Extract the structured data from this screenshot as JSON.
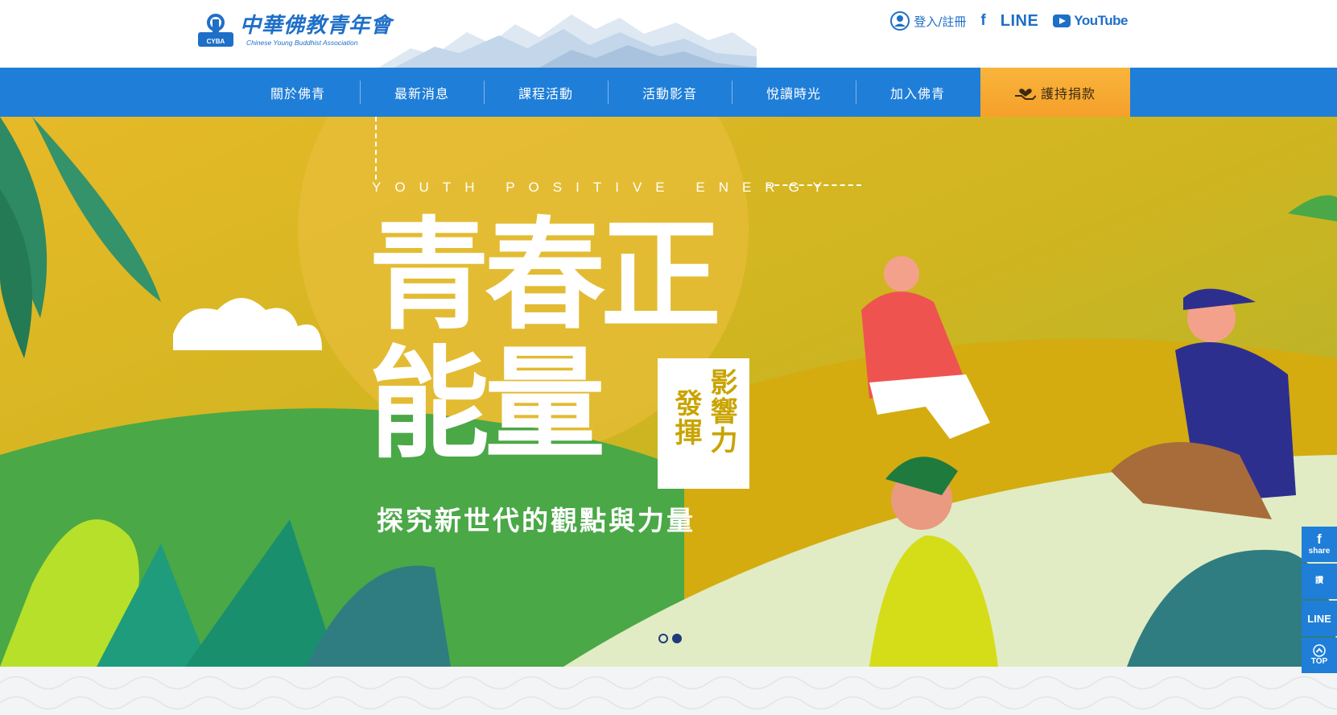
{
  "header": {
    "logo_title": "中華佛教青年會",
    "logo_sub": "Chinese Young Buddhist Association",
    "logo_badge": "CYBA",
    "login_label": "登入/註冊",
    "social": {
      "facebook": "f",
      "line": "LINE",
      "youtube": "YouTube"
    }
  },
  "nav": {
    "items": [
      {
        "label": "關於佛青"
      },
      {
        "label": "最新消息"
      },
      {
        "label": "課程活動"
      },
      {
        "label": "活動影音"
      },
      {
        "label": "悅讀時光"
      },
      {
        "label": "加入佛青"
      }
    ],
    "donate_label": "護持捐款"
  },
  "hero": {
    "tagline": "YOUTH POSITIVE ENERGY",
    "headline_line1": "青春正",
    "headline_line2": "能量",
    "box_col1": "影響力",
    "box_col2": "發揮",
    "subheading": "探究新世代的觀點與力量",
    "slide_count": 2,
    "active_slide": 2
  },
  "floatbar": {
    "share_icon": "f",
    "share_label": "share",
    "like_label": "讚",
    "line_label": "LINE",
    "top_label": "TOP"
  },
  "colors": {
    "brand_blue": "#1f7ed8",
    "donate_orange": "#f7a934",
    "hero_yellow": "#d6b10e",
    "hero_green": "#4aa847"
  }
}
